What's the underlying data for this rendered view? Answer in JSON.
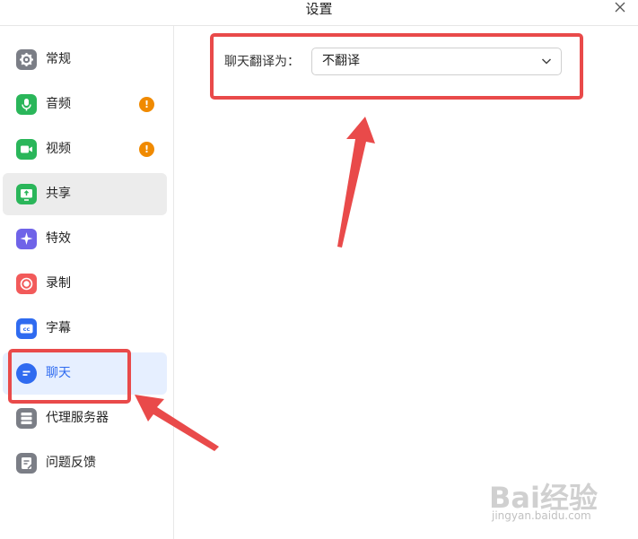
{
  "window": {
    "title": "设置"
  },
  "sidebar": {
    "items": [
      {
        "label": "常规",
        "icon": "gear-icon",
        "color": "#7b7e86"
      },
      {
        "label": "音频",
        "icon": "microphone-icon",
        "color": "#2ab65a",
        "badge": "!"
      },
      {
        "label": "视频",
        "icon": "video-camera-icon",
        "color": "#2ab65a",
        "badge": "!"
      },
      {
        "label": "共享",
        "icon": "screen-share-icon",
        "color": "#2ab65a"
      },
      {
        "label": "特效",
        "icon": "sparkle-icon",
        "color": "#6f63e8"
      },
      {
        "label": "录制",
        "icon": "record-icon",
        "color": "#f25a5a"
      },
      {
        "label": "字幕",
        "icon": "captions-icon",
        "color": "#2f6bf0"
      },
      {
        "label": "聊天",
        "icon": "chat-icon",
        "color": "#2f6bf0",
        "selected": true
      },
      {
        "label": "代理服务器",
        "icon": "server-icon",
        "color": "#7b7e86"
      },
      {
        "label": "问题反馈",
        "icon": "feedback-icon",
        "color": "#7b7e86"
      }
    ]
  },
  "chat_settings": {
    "translate_label": "聊天翻译为：",
    "translate_value": "不翻译"
  },
  "colors": {
    "accent": "#2f6bf0",
    "annotation": "#e94a4a",
    "badge": "#f08a00"
  },
  "watermark": {
    "brand": "Bai经验",
    "url": "jingyan.baidu.com"
  }
}
